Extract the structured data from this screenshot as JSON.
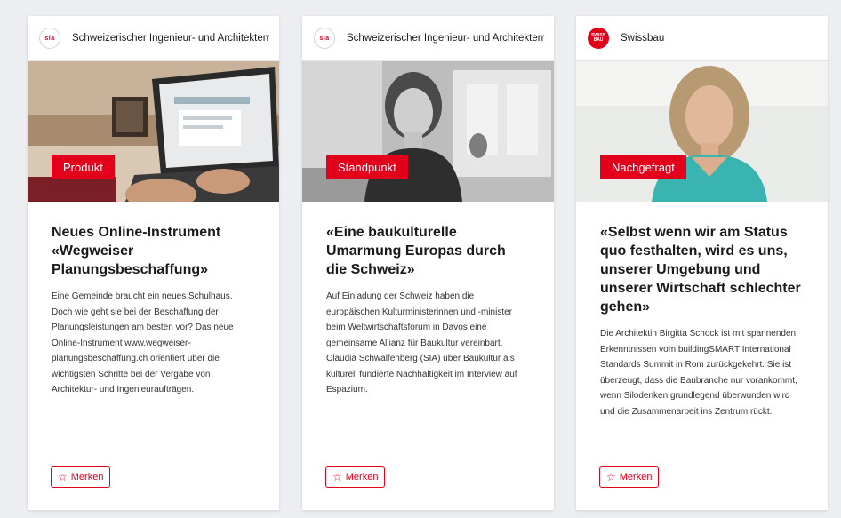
{
  "cards": [
    {
      "publisher": "Schweizerischer Ingenieur- und Architektenverein",
      "logo_text": "sia",
      "category": "Produkt",
      "title": "Neues Online-Instrument «Wegweiser Planungsbeschaffung»",
      "text": "Eine Gemeinde braucht ein neues Schulhaus. Doch wie geht sie bei der Beschaffung der Planungsleistungen am besten vor? Das neue Online-Instrument www.wegweiser-planungsbeschaffung.ch orientiert über die wichtigsten Schritte bei der Vergabe von Architektur- und Ingenieuraufträgen.",
      "save_label": "Merken"
    },
    {
      "publisher": "Schweizerischer Ingenieur- und Architektenverein",
      "logo_text": "sia",
      "category": "Standpunkt",
      "title": "«Eine baukulturelle Umarmung Europas durch die Schweiz»",
      "text": "Auf Einladung der Schweiz haben die europäischen Kulturministerinnen und -minister beim Weltwirtschaftsforum in Davos eine gemeinsame Allianz für Baukultur vereinbart. Claudia Schwalfenberg (SIA) über Baukultur als kulturell fundierte Nachhaltigkeit im Interview auf Espazium.",
      "save_label": "Merken"
    },
    {
      "publisher": "Swissbau",
      "logo_text": "SWISS BAU",
      "category": "Nachgefragt",
      "title": "«Selbst wenn wir am Status quo festhalten, wird es uns, unserer Umgebung und unserer Wirtschaft schlechter gehen»",
      "text": "Die Architektin Birgitta Schock ist mit spannenden Erkenntnissen vom buildingSMART International Standards Summit in Rom zurückgekehrt. Sie ist überzeugt, dass die Baubranche nur vorankommt, wenn Silodenken grundlegend überwunden wird und die Zusammenarbeit ins Zentrum rückt.",
      "save_label": "Merken"
    }
  ],
  "colors": {
    "accent": "#e2001a",
    "background": "#eceef1",
    "card": "#ffffff"
  }
}
